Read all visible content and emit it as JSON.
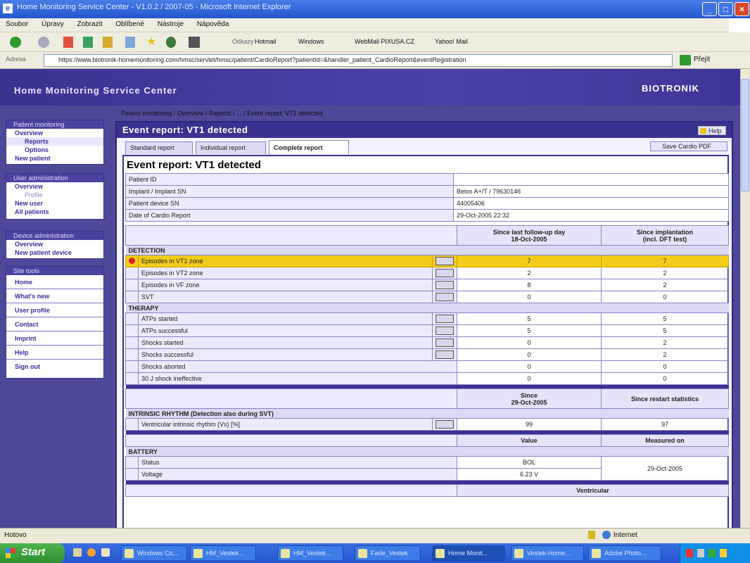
{
  "window": {
    "title": "Home Monitoring Service Center - V1.0.2 / 2007-05 - Microsoft Internet Explorer"
  },
  "menu": [
    "Soubor",
    "Úpravy",
    "Zobrazit",
    "Oblíbené",
    "Nástroje",
    "Nápověda"
  ],
  "links": {
    "label": "Odkazy",
    "items": [
      "Hotmail",
      "Windows",
      "WebMail PIXUSA.CZ",
      "Yahoo! Mail"
    ]
  },
  "address": {
    "label": "Adresa",
    "url": "https://www.biotronik-homemonitoring.com/hmsc/servlet/hmsc/patient/CardioReport?patientId=&handler_patient_CardioReport&eventRegistration",
    "go": "Přejít"
  },
  "header": {
    "title": "Home Monitoring Service Center",
    "brand": "BIOTRONIK"
  },
  "sidebar": {
    "patient_monitoring": {
      "heading": "Patient monitoring",
      "items": [
        "Overview",
        "Reports",
        "Options",
        "New patient"
      ]
    },
    "user_admin": {
      "heading": "User administration",
      "items": [
        "Overview",
        "Profile",
        "New user",
        "All patients"
      ]
    },
    "device_admin": {
      "heading": "Device administration",
      "items": [
        "Overview",
        "New patient device"
      ]
    },
    "site_tools": {
      "heading": "Site tools",
      "items": [
        "Home",
        "What's new",
        "User profile",
        "Contact",
        "Imprint",
        "Help",
        "Sign out"
      ]
    }
  },
  "breadcrumb": "Patient monitoring / Overview / Reports / ... / Event report: VT1 detected",
  "page": {
    "title": "Event report: VT1 detected",
    "help": "Help",
    "tabs": [
      "Standard report",
      "Individual report",
      "Complete report"
    ],
    "pdf": "Save Cardio PDF",
    "heading": "Event report: VT1 detected"
  },
  "info": [
    {
      "label": "Patient ID",
      "value": ""
    },
    {
      "label": "Implant / Implant SN",
      "value": "Belos A+/T / 79630146"
    },
    {
      "label": "Patient device SN",
      "value": "44005406"
    },
    {
      "label": "Date of Cardio Report",
      "value": "29-Oct-2005 22:32"
    }
  ],
  "stats_header": {
    "col1": "Since last follow-up day",
    "col1b": "18-Oct-2005",
    "col2": "Since implantation",
    "col2b": "(incl. DFT test)"
  },
  "detection": {
    "label": "DETECTION",
    "rows": [
      {
        "name": "Episodes in VT1 zone",
        "a": "7",
        "b": "7",
        "alert": true
      },
      {
        "name": "Episodes in VT2 zone",
        "a": "2",
        "b": "2"
      },
      {
        "name": "Episodes in VF zone",
        "a": "8",
        "b": "2"
      },
      {
        "name": "SVT",
        "a": "0",
        "b": "0"
      }
    ]
  },
  "therapy": {
    "label": "THERAPY",
    "rows": [
      {
        "name": "ATPs started",
        "a": "5",
        "b": "5"
      },
      {
        "name": "ATPs successful",
        "a": "5",
        "b": "5"
      },
      {
        "name": "Shocks started",
        "a": "0",
        "b": "2"
      },
      {
        "name": "Shocks successful",
        "a": "0",
        "b": "2"
      },
      {
        "name": "Shocks aborted",
        "a": "0",
        "b": "0"
      },
      {
        "name": "30 J shock ineffective",
        "a": "0",
        "b": "0"
      }
    ]
  },
  "intrinsic": {
    "col1": "Since",
    "col1b": "29-Oct-2005",
    "col2": "Since restart statistics",
    "label": "INTRINSIC RHYTHM (Detection also during SVT)",
    "rows": [
      {
        "name": "Ventricular intrinsic rhythm (Vs) [%]",
        "a": "99",
        "b": "97"
      }
    ]
  },
  "battery": {
    "col1": "Value",
    "col2": "Measured on",
    "label": "BATTERY",
    "rows": [
      {
        "name": "Status",
        "a": "BOL"
      },
      {
        "name": "Voltage",
        "a": "6.23 V"
      }
    ],
    "measured": "29-Oct-2005"
  },
  "ventricular": "Ventricular",
  "status": {
    "left": "Hotovo",
    "zone": "Internet"
  },
  "taskbar": {
    "start": "Start",
    "tasks": [
      "Windows Co...",
      "HM_Vestek...",
      "HM_Vestek...",
      "Fade_Vestek",
      "Home Monit...",
      "Vestek-Home...",
      "Adobe Photo..."
    ]
  }
}
